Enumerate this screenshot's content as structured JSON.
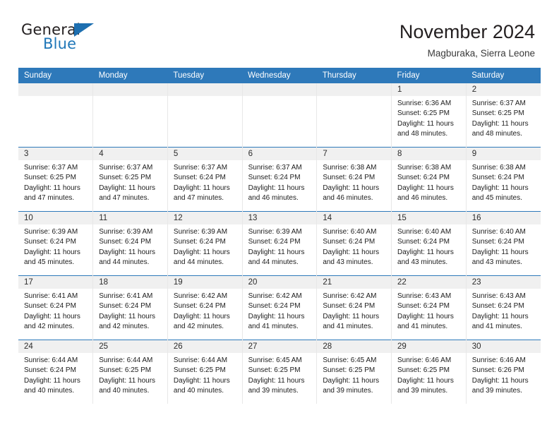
{
  "brand": {
    "word_one": "General",
    "word_two": "Blue",
    "triangle_icon": "triangle-icon",
    "accent_color": "#2077b8"
  },
  "header": {
    "title": "November 2024",
    "location": "Magburaka, Sierra Leone"
  },
  "theme": {
    "header_bar": "#2e79ba",
    "daynum_strip": "#f0f0f0",
    "text": "#231f20"
  },
  "calendar": {
    "weekdays": [
      "Sunday",
      "Monday",
      "Tuesday",
      "Wednesday",
      "Thursday",
      "Friday",
      "Saturday"
    ],
    "labels": {
      "sunrise": "Sunrise:",
      "sunset": "Sunset:",
      "daylight": "Daylight:"
    },
    "weeks": [
      [
        {
          "day": ""
        },
        {
          "day": ""
        },
        {
          "day": ""
        },
        {
          "day": ""
        },
        {
          "day": ""
        },
        {
          "day": "1",
          "sunrise": "Sunrise: 6:36 AM",
          "sunset": "Sunset: 6:25 PM",
          "daylight_1": "Daylight: 11 hours",
          "daylight_2": "and 48 minutes."
        },
        {
          "day": "2",
          "sunrise": "Sunrise: 6:37 AM",
          "sunset": "Sunset: 6:25 PM",
          "daylight_1": "Daylight: 11 hours",
          "daylight_2": "and 48 minutes."
        }
      ],
      [
        {
          "day": "3",
          "sunrise": "Sunrise: 6:37 AM",
          "sunset": "Sunset: 6:25 PM",
          "daylight_1": "Daylight: 11 hours",
          "daylight_2": "and 47 minutes."
        },
        {
          "day": "4",
          "sunrise": "Sunrise: 6:37 AM",
          "sunset": "Sunset: 6:25 PM",
          "daylight_1": "Daylight: 11 hours",
          "daylight_2": "and 47 minutes."
        },
        {
          "day": "5",
          "sunrise": "Sunrise: 6:37 AM",
          "sunset": "Sunset: 6:24 PM",
          "daylight_1": "Daylight: 11 hours",
          "daylight_2": "and 47 minutes."
        },
        {
          "day": "6",
          "sunrise": "Sunrise: 6:37 AM",
          "sunset": "Sunset: 6:24 PM",
          "daylight_1": "Daylight: 11 hours",
          "daylight_2": "and 46 minutes."
        },
        {
          "day": "7",
          "sunrise": "Sunrise: 6:38 AM",
          "sunset": "Sunset: 6:24 PM",
          "daylight_1": "Daylight: 11 hours",
          "daylight_2": "and 46 minutes."
        },
        {
          "day": "8",
          "sunrise": "Sunrise: 6:38 AM",
          "sunset": "Sunset: 6:24 PM",
          "daylight_1": "Daylight: 11 hours",
          "daylight_2": "and 46 minutes."
        },
        {
          "day": "9",
          "sunrise": "Sunrise: 6:38 AM",
          "sunset": "Sunset: 6:24 PM",
          "daylight_1": "Daylight: 11 hours",
          "daylight_2": "and 45 minutes."
        }
      ],
      [
        {
          "day": "10",
          "sunrise": "Sunrise: 6:39 AM",
          "sunset": "Sunset: 6:24 PM",
          "daylight_1": "Daylight: 11 hours",
          "daylight_2": "and 45 minutes."
        },
        {
          "day": "11",
          "sunrise": "Sunrise: 6:39 AM",
          "sunset": "Sunset: 6:24 PM",
          "daylight_1": "Daylight: 11 hours",
          "daylight_2": "and 44 minutes."
        },
        {
          "day": "12",
          "sunrise": "Sunrise: 6:39 AM",
          "sunset": "Sunset: 6:24 PM",
          "daylight_1": "Daylight: 11 hours",
          "daylight_2": "and 44 minutes."
        },
        {
          "day": "13",
          "sunrise": "Sunrise: 6:39 AM",
          "sunset": "Sunset: 6:24 PM",
          "daylight_1": "Daylight: 11 hours",
          "daylight_2": "and 44 minutes."
        },
        {
          "day": "14",
          "sunrise": "Sunrise: 6:40 AM",
          "sunset": "Sunset: 6:24 PM",
          "daylight_1": "Daylight: 11 hours",
          "daylight_2": "and 43 minutes."
        },
        {
          "day": "15",
          "sunrise": "Sunrise: 6:40 AM",
          "sunset": "Sunset: 6:24 PM",
          "daylight_1": "Daylight: 11 hours",
          "daylight_2": "and 43 minutes."
        },
        {
          "day": "16",
          "sunrise": "Sunrise: 6:40 AM",
          "sunset": "Sunset: 6:24 PM",
          "daylight_1": "Daylight: 11 hours",
          "daylight_2": "and 43 minutes."
        }
      ],
      [
        {
          "day": "17",
          "sunrise": "Sunrise: 6:41 AM",
          "sunset": "Sunset: 6:24 PM",
          "daylight_1": "Daylight: 11 hours",
          "daylight_2": "and 42 minutes."
        },
        {
          "day": "18",
          "sunrise": "Sunrise: 6:41 AM",
          "sunset": "Sunset: 6:24 PM",
          "daylight_1": "Daylight: 11 hours",
          "daylight_2": "and 42 minutes."
        },
        {
          "day": "19",
          "sunrise": "Sunrise: 6:42 AM",
          "sunset": "Sunset: 6:24 PM",
          "daylight_1": "Daylight: 11 hours",
          "daylight_2": "and 42 minutes."
        },
        {
          "day": "20",
          "sunrise": "Sunrise: 6:42 AM",
          "sunset": "Sunset: 6:24 PM",
          "daylight_1": "Daylight: 11 hours",
          "daylight_2": "and 41 minutes."
        },
        {
          "day": "21",
          "sunrise": "Sunrise: 6:42 AM",
          "sunset": "Sunset: 6:24 PM",
          "daylight_1": "Daylight: 11 hours",
          "daylight_2": "and 41 minutes."
        },
        {
          "day": "22",
          "sunrise": "Sunrise: 6:43 AM",
          "sunset": "Sunset: 6:24 PM",
          "daylight_1": "Daylight: 11 hours",
          "daylight_2": "and 41 minutes."
        },
        {
          "day": "23",
          "sunrise": "Sunrise: 6:43 AM",
          "sunset": "Sunset: 6:24 PM",
          "daylight_1": "Daylight: 11 hours",
          "daylight_2": "and 41 minutes."
        }
      ],
      [
        {
          "day": "24",
          "sunrise": "Sunrise: 6:44 AM",
          "sunset": "Sunset: 6:24 PM",
          "daylight_1": "Daylight: 11 hours",
          "daylight_2": "and 40 minutes."
        },
        {
          "day": "25",
          "sunrise": "Sunrise: 6:44 AM",
          "sunset": "Sunset: 6:25 PM",
          "daylight_1": "Daylight: 11 hours",
          "daylight_2": "and 40 minutes."
        },
        {
          "day": "26",
          "sunrise": "Sunrise: 6:44 AM",
          "sunset": "Sunset: 6:25 PM",
          "daylight_1": "Daylight: 11 hours",
          "daylight_2": "and 40 minutes."
        },
        {
          "day": "27",
          "sunrise": "Sunrise: 6:45 AM",
          "sunset": "Sunset: 6:25 PM",
          "daylight_1": "Daylight: 11 hours",
          "daylight_2": "and 39 minutes."
        },
        {
          "day": "28",
          "sunrise": "Sunrise: 6:45 AM",
          "sunset": "Sunset: 6:25 PM",
          "daylight_1": "Daylight: 11 hours",
          "daylight_2": "and 39 minutes."
        },
        {
          "day": "29",
          "sunrise": "Sunrise: 6:46 AM",
          "sunset": "Sunset: 6:25 PM",
          "daylight_1": "Daylight: 11 hours",
          "daylight_2": "and 39 minutes."
        },
        {
          "day": "30",
          "sunrise": "Sunrise: 6:46 AM",
          "sunset": "Sunset: 6:26 PM",
          "daylight_1": "Daylight: 11 hours",
          "daylight_2": "and 39 minutes."
        }
      ]
    ]
  }
}
